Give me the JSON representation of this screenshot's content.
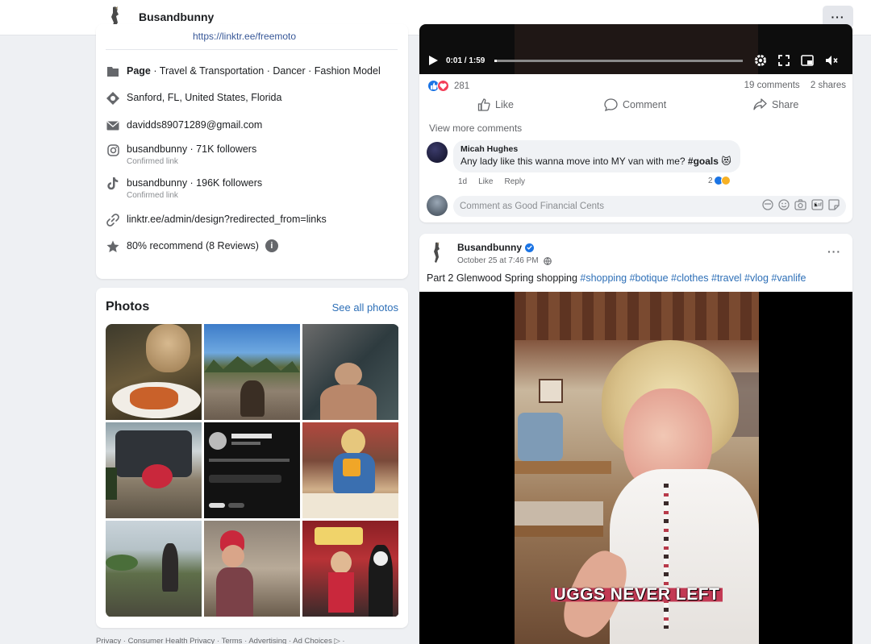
{
  "header": {
    "page_name": "Busandbunny",
    "more_label": "···"
  },
  "intro": {
    "top_link": "https://linktr.ee/freemoto",
    "items": [
      {
        "icon": "flag-icon",
        "bold": "Page",
        "text": " · Travel & Transportation · Dancer · Fashion Model"
      },
      {
        "icon": "location-icon",
        "text": "Sanford, FL, United States, Florida"
      },
      {
        "icon": "mail-icon",
        "text": "davidds89071289@gmail.com"
      },
      {
        "icon": "instagram-icon",
        "link": "busandbunny · 71K followers",
        "sub": "Confirmed link"
      },
      {
        "icon": "tiktok-icon",
        "link": "busandbunny · 196K followers",
        "sub": "Confirmed link"
      },
      {
        "icon": "link-icon",
        "text": "linktr.ee/admin/design?redirected_from=links"
      },
      {
        "icon": "star-icon",
        "text": "80% recommend (8 Reviews)"
      }
    ]
  },
  "photos": {
    "title": "Photos",
    "see_all": "See all photos"
  },
  "footer": {
    "links": "Privacy · Consumer Health Privacy · Terms · Advertising · Ad Choices ▷ ·"
  },
  "post1": {
    "time": "0:01 / 1:59",
    "progress": 0.01,
    "reactions_count": "281",
    "comments_count": "19 comments",
    "shares_count": "2 shares",
    "actions": {
      "like": "Like",
      "comment": "Comment",
      "share": "Share"
    },
    "view_more": "View more comments",
    "comment": {
      "author": "Micah Hughes",
      "text_prefix": "Any lady like this wanna move into MY van with me? ",
      "hashtag": "#goals",
      "emoji": "😻",
      "age": "1d",
      "like_label": "Like",
      "reply_label": "Reply",
      "reaction_count": "2"
    },
    "input_placeholder": "Comment as Good Financial Cents"
  },
  "post2": {
    "author": "Busandbunny",
    "date": "October 25 at 7:46 PM",
    "caption_prefix": "Part 2 Glenwood Spring shopping ",
    "hashtags": "#shopping #botique #clothes #travel #vlog #vanlife",
    "video_overlay": "UGGS NEVER LEFT"
  },
  "colors": {
    "link_blue": "#2d6fb7",
    "background": "#eef0f3",
    "card": "#ffffff",
    "muted": "#65676b",
    "verified": "#1b74e4"
  }
}
